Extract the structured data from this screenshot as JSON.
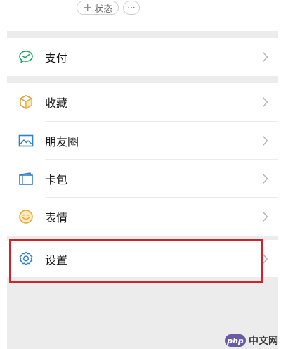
{
  "header": {
    "status_button": {
      "icon": "plus-icon",
      "label": "状态"
    },
    "more_button": {
      "icon": "more-icon",
      "label": "···"
    }
  },
  "menu": {
    "pay": {
      "label": "支付",
      "icon": "wechat-pay-icon"
    },
    "favorites": {
      "label": "收藏",
      "icon": "cube-icon"
    },
    "moments": {
      "label": "朋友圈",
      "icon": "image-icon"
    },
    "cards": {
      "label": "卡包",
      "icon": "wallet-icon"
    },
    "stickers": {
      "label": "表情",
      "icon": "smiley-icon"
    },
    "settings": {
      "label": "设置",
      "icon": "gear-icon"
    }
  },
  "watermark": {
    "logo_text": "php",
    "site_text": "中文网"
  },
  "colors": {
    "highlight_border": "#d3222a",
    "background_gray": "#ececec",
    "pay_green": "#1aad5c",
    "favorites_gold": "#e2a23b",
    "blue_icon": "#2f7fc9",
    "stickers_gold": "#e7ad3c"
  }
}
